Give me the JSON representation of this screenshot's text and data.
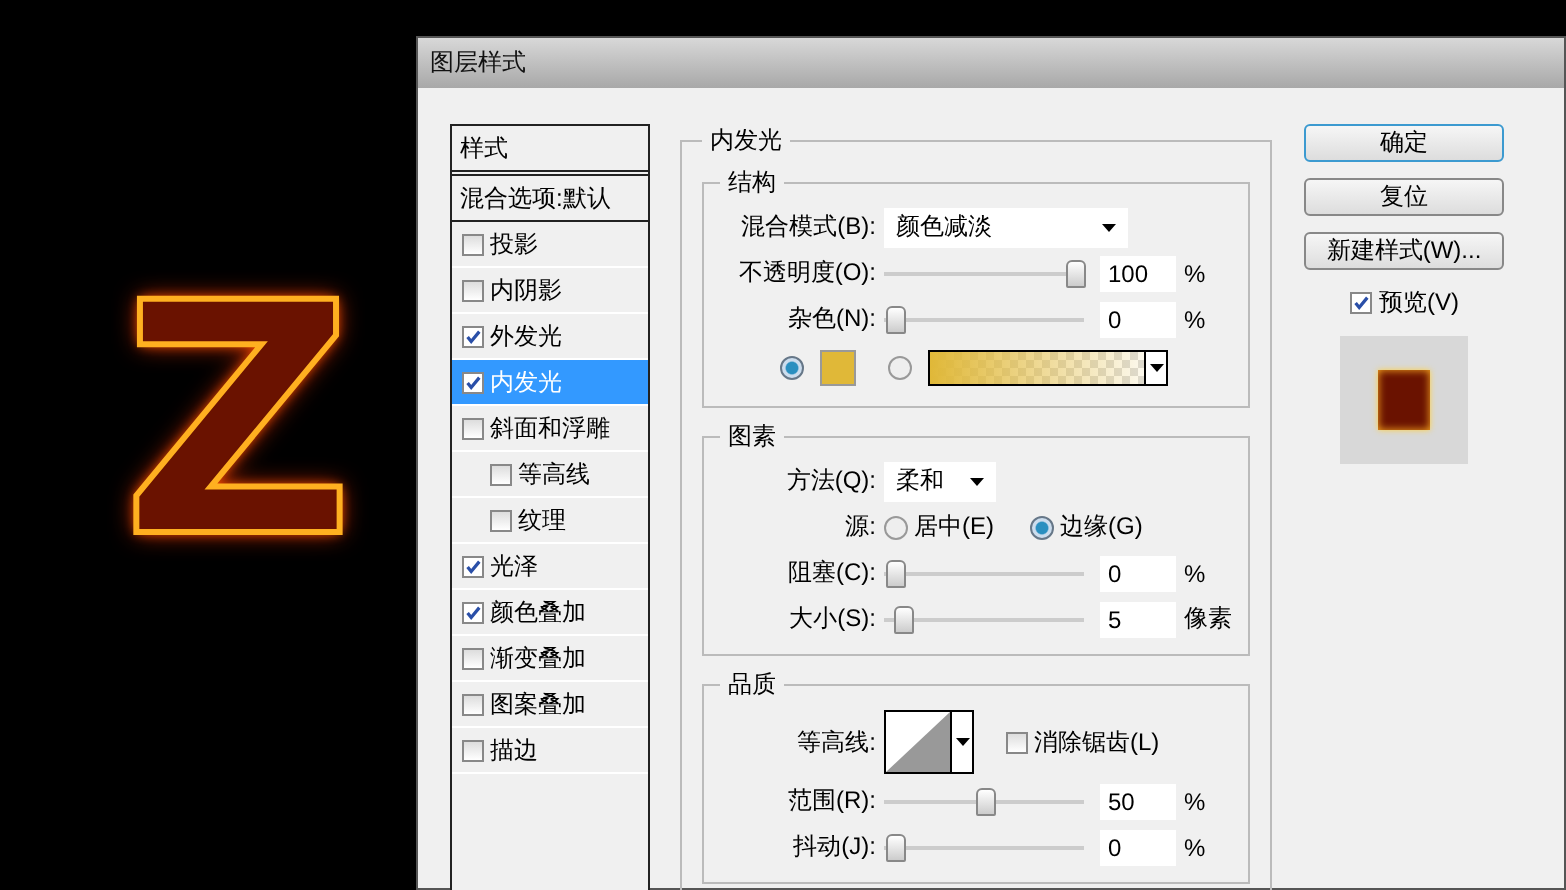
{
  "canvas": {
    "letter": "Z"
  },
  "dialog": {
    "title": "图层样式"
  },
  "styles_list": {
    "header": "样式",
    "blend_options": "混合选项:默认",
    "items": [
      {
        "label": "投影",
        "checked": false,
        "selected": false
      },
      {
        "label": "内阴影",
        "checked": false,
        "selected": false
      },
      {
        "label": "外发光",
        "checked": true,
        "selected": false
      },
      {
        "label": "内发光",
        "checked": true,
        "selected": true
      },
      {
        "label": "斜面和浮雕",
        "checked": false,
        "selected": false,
        "children": [
          {
            "label": "等高线",
            "checked": false,
            "selected": false
          },
          {
            "label": "纹理",
            "checked": false,
            "selected": false
          }
        ]
      },
      {
        "label": "光泽",
        "checked": true,
        "selected": false
      },
      {
        "label": "颜色叠加",
        "checked": true,
        "selected": false
      },
      {
        "label": "渐变叠加",
        "checked": false,
        "selected": false
      },
      {
        "label": "图案叠加",
        "checked": false,
        "selected": false
      },
      {
        "label": "描边",
        "checked": false,
        "selected": false
      }
    ]
  },
  "inner_glow": {
    "title": "内发光",
    "structure": {
      "title": "结构",
      "blend_mode": {
        "label": "混合模式(B):",
        "value": "颜色减淡"
      },
      "opacity": {
        "label": "不透明度(O):",
        "level": 1,
        "value": "100",
        "unit": "%"
      },
      "noise": {
        "label": "杂色(N):",
        "level": 0,
        "value": "0",
        "unit": "%"
      },
      "fill_options": [
        {
          "kind": "color",
          "selected": true
        },
        {
          "kind": "gradient",
          "selected": false
        }
      ]
    },
    "elements": {
      "title": "图素",
      "technique": {
        "label": "方法(Q):",
        "value": "柔和"
      },
      "source": {
        "label": "源:",
        "options": [
          {
            "label": "居中(E)",
            "selected": false
          },
          {
            "label": "边缘(G)",
            "selected": true
          }
        ]
      },
      "choke": {
        "label": "阻塞(C):",
        "level": 0,
        "value": "0",
        "unit": "%"
      },
      "size": {
        "label": "大小(S):",
        "level": 0.04,
        "value": "5",
        "unit": "像素"
      }
    },
    "quality": {
      "title": "品质",
      "contour": {
        "label": "等高线:"
      },
      "anti_alias": {
        "label": "消除锯齿(L)",
        "checked": false
      },
      "range": {
        "label": "范围(R):",
        "level": 0.5,
        "value": "50",
        "unit": "%"
      },
      "jitter": {
        "label": "抖动(J):",
        "level": 0,
        "value": "0",
        "unit": "%"
      }
    }
  },
  "buttons": [
    {
      "label": "确定",
      "default": true
    },
    {
      "label": "复位",
      "default": false
    },
    {
      "label": "新建样式(W)...",
      "default": false
    }
  ],
  "preview": {
    "label": "预览(V)",
    "checked": true
  }
}
